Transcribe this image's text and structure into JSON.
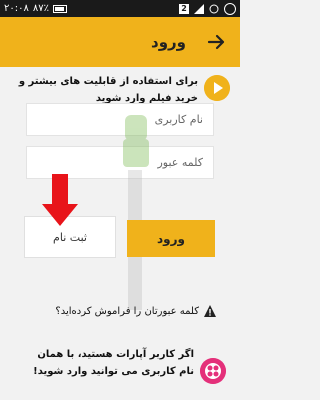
{
  "status_bar": {
    "time": "۲۰:۰۸",
    "battery": "۸۷٪",
    "notification_count": "2"
  },
  "app_bar": {
    "title": "ورود"
  },
  "promo": {
    "text": "برای استفاده از قابلیت های بیشتر و خرید فیلم وارد شوید"
  },
  "form": {
    "username_placeholder": "نام کاربری",
    "password_placeholder": "کلمه عبور",
    "login_label": "ورود",
    "register_label": "ثبت نام",
    "forgot_label": "کلمه عبورتان را فراموش کرده‌اید؟"
  },
  "footer": {
    "text": "اگر کاربر آپارات هستید، با همان نام کاربری می توانید وارد شوید!"
  },
  "colors": {
    "accent": "#f0b21b",
    "aparat": "#e4307a",
    "arrow": "#e8141a"
  }
}
